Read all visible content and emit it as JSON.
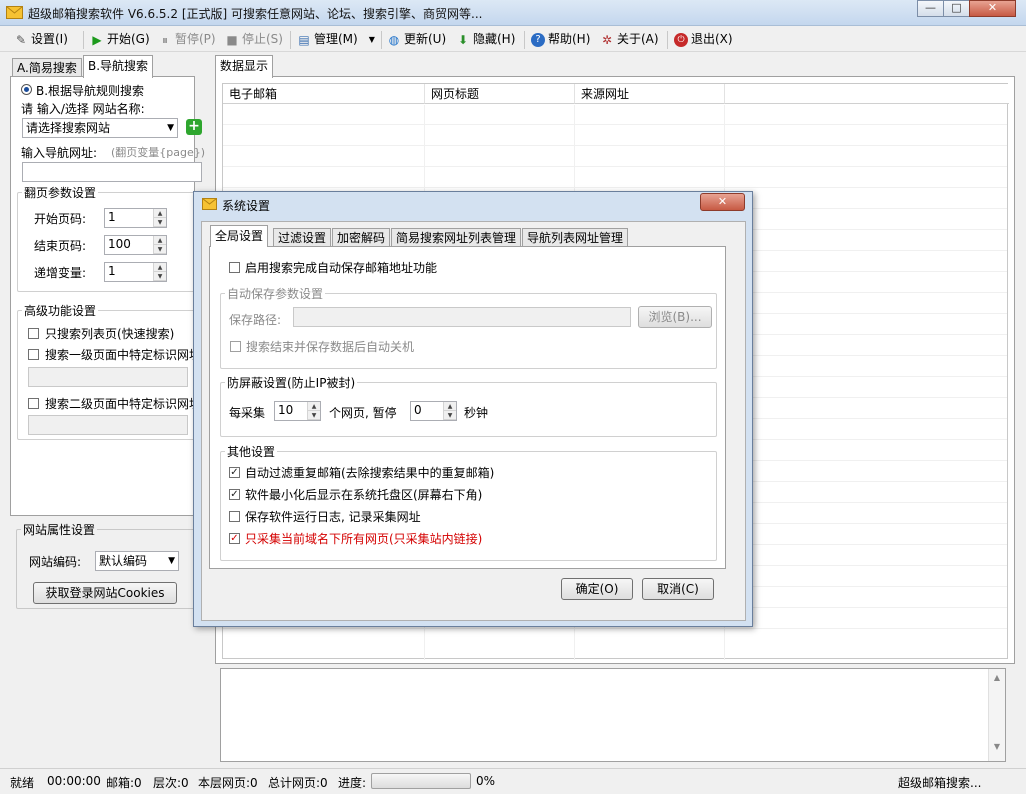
{
  "window": {
    "title": "超级邮箱搜索软件 V6.6.5.2 [正式版] 可搜索任意网站、论坛、搜索引擎、商贸网等...",
    "minimize": "—",
    "maximize": "□",
    "close": "✕"
  },
  "toolbar": {
    "settings": "设置(I)",
    "start": "开始(G)",
    "pause": "暂停(P)",
    "stop": "停止(S)",
    "manage": "管理(M)",
    "update": "更新(U)",
    "hide": "隐藏(H)",
    "help": "帮助(H)",
    "about": "关于(A)",
    "exit": "退出(X)"
  },
  "left_panel": {
    "tabs": [
      "A.简易搜索",
      "B.导航搜索"
    ],
    "radio_label": "B.根据导航规则搜索",
    "site_name_label": "请 输入/选择 网站名称:",
    "site_combo": "请选择搜索网站",
    "nav_url_label": "输入导航网址:",
    "nav_url_hint": "(翻页变量{page})",
    "paging_group": "翻页参数设置",
    "start_page_label": "开始页码:",
    "start_page": "1",
    "end_page_label": "结束页码:",
    "end_page": "100",
    "increment_label": "递增变量:",
    "increment": "1",
    "advanced_group": "高级功能设置",
    "only_list_page": "只搜索列表页(快速搜索)",
    "level1_specific": "搜索一级页面中特定标识网址",
    "level2_specific": "搜索二级页面中特定标识网址",
    "site_attr_group": "网站属性设置",
    "encoding_label": "网站编码:",
    "encoding_value": "默认编码",
    "cookies_button": "获取登录网站Cookies"
  },
  "data_panel": {
    "tab": "数据显示",
    "columns": [
      "电子邮箱",
      "网页标题",
      "来源网址"
    ]
  },
  "status": {
    "ready": "就绪",
    "time": "00:00:00",
    "mailbox": "邮箱:0",
    "level": "层次:0",
    "current_pages": "本层网页:0",
    "total_pages": "总计网页:0",
    "progress_label": "进度:",
    "progress_percent": "0%",
    "progress_value": 0,
    "right_text": "超级邮箱搜索..."
  },
  "dialog": {
    "title": "系统设置",
    "close": "✕",
    "tabs": [
      "全局设置",
      "过滤设置",
      "加密解码",
      "简易搜索网址列表管理",
      "导航列表网址管理"
    ],
    "auto_save_enable": "启用搜索完成自动保存邮箱地址功能",
    "auto_save_group": "自动保存参数设置",
    "save_path_label": "保存路径:",
    "save_path_value": "",
    "browse_button": "浏览(B)...",
    "shutdown_after": "搜索结束并保存数据后自动关机",
    "anti_block_group": "防屏蔽设置(防止IP被封)",
    "every_label": "每采集",
    "every_value": "10",
    "pages_pause_label": "个网页, 暂停",
    "pause_value": "0",
    "seconds_label": "秒钟",
    "other_group": "其他设置",
    "opt_filter_dup": "自动过滤重复邮箱(去除搜索结果中的重复邮箱)",
    "opt_tray": "软件最小化后显示在系统托盘区(屏幕右下角)",
    "opt_log": "保存软件运行日志, 记录采集网址",
    "opt_same_domain": "只采集当前域名下所有网页(只采集站内链接)",
    "ok_button": "确定(O)",
    "cancel_button": "取消(C)",
    "warning_color": "#d40000"
  }
}
